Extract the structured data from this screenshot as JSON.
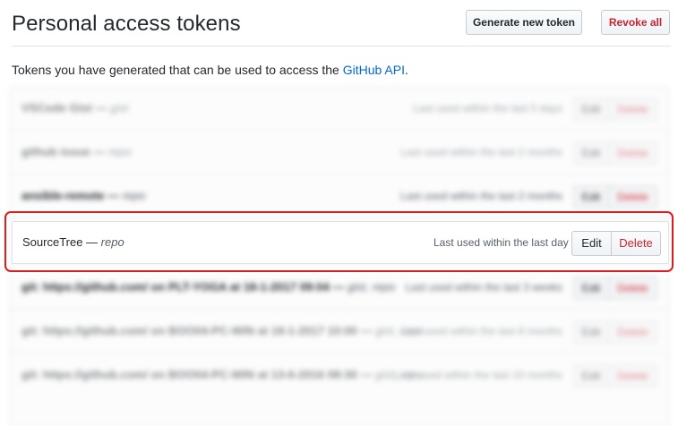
{
  "header": {
    "title": "Personal access tokens",
    "generate_label": "Generate new token",
    "revoke_label": "Revoke all"
  },
  "intro": {
    "text": "Tokens you have generated that can be used to access the ",
    "link": "GitHub API",
    "suffix": "."
  },
  "tokens": [
    {
      "name": "VSCode Gist",
      "scope": "gist",
      "used": "Last used within the last 5 days",
      "edit": "Edit",
      "delete": "Delete"
    },
    {
      "name": "github issue",
      "scope": "repo",
      "used": "Last used within the last 2 months",
      "edit": "Edit",
      "delete": "Delete"
    },
    {
      "name": "ansible-remote",
      "scope": "repo",
      "used": "Last used within the last 2 months",
      "edit": "Edit",
      "delete": "Delete"
    },
    {
      "name": "SourceTree",
      "scope": "repo",
      "used": "Last used within the last day",
      "edit": "Edit",
      "delete": "Delete"
    },
    {
      "name": "git: https://github.com/ on PLT-YOGA at 18-1-2017 09:04",
      "scope": "gist, repo",
      "used": "Last used within the last 3 weeks",
      "edit": "Edit",
      "delete": "Delete"
    },
    {
      "name": "git: https://github.com/ on BOO04-PC-WIN at 18-1-2017 10:00",
      "scope": "gist, repo",
      "used": "Last used within the last 8 months",
      "edit": "Edit",
      "delete": "Delete"
    },
    {
      "name": "git: https://github.com/ on BOO04-PC-WIN at 13-6-2016 08:30",
      "scope": "gist, repo",
      "used": "Last used within the last 10 months",
      "edit": "Edit",
      "delete": "Delete"
    }
  ],
  "colors": {
    "link": "#0366d6",
    "danger": "#cb2431",
    "highlight": "#e01b1b"
  }
}
